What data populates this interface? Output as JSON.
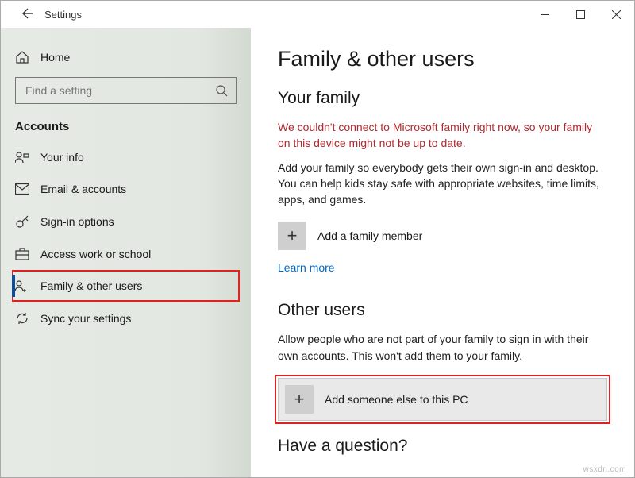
{
  "titlebar": {
    "title": "Settings"
  },
  "sidebar": {
    "home_label": "Home",
    "search_placeholder": "Find a setting",
    "section": "Accounts",
    "items": [
      {
        "label": "Your info"
      },
      {
        "label": "Email & accounts"
      },
      {
        "label": "Sign-in options"
      },
      {
        "label": "Access work or school"
      },
      {
        "label": "Family & other users"
      },
      {
        "label": "Sync your settings"
      }
    ]
  },
  "main": {
    "heading": "Family & other users",
    "family": {
      "title": "Your family",
      "error": "We couldn't connect to Microsoft family right now, so your family on this device might not be up to date.",
      "para": "Add your family so everybody gets their own sign-in and desktop. You can help kids stay safe with appropriate websites, time limits, apps, and games.",
      "add_label": "Add a family member",
      "learn_more": "Learn more"
    },
    "others": {
      "title": "Other users",
      "para": "Allow people who are not part of your family to sign in with their own accounts. This won't add them to your family.",
      "add_label": "Add someone else to this PC"
    },
    "question": "Have a question?"
  },
  "watermark": "wsxdn.com"
}
